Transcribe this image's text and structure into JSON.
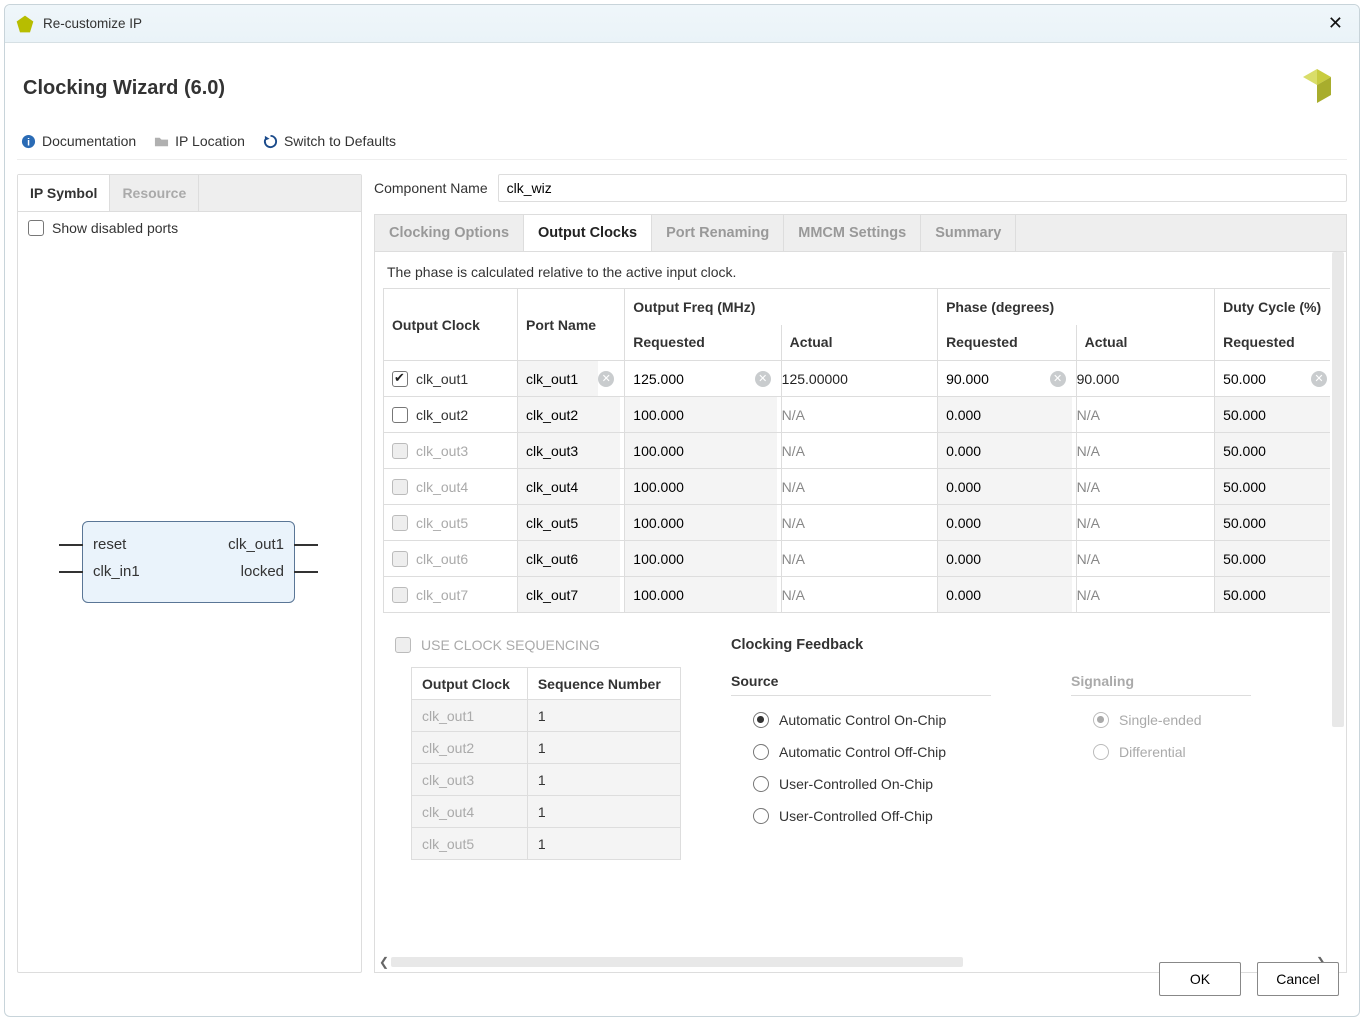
{
  "window": {
    "title": "Re-customize IP"
  },
  "header": {
    "title": "Clocking Wizard (6.0)"
  },
  "toolbar": {
    "documentation": "Documentation",
    "ip_location": "IP Location",
    "switch_defaults": "Switch to Defaults"
  },
  "left_panel": {
    "tabs": {
      "ip_symbol": "IP Symbol",
      "resource": "Resource"
    },
    "show_disabled": "Show disabled ports",
    "symbol": {
      "reset": "reset",
      "clk_in1": "clk_in1",
      "clk_out1": "clk_out1",
      "locked": "locked"
    }
  },
  "component": {
    "label": "Component Name",
    "value": "clk_wiz"
  },
  "right_tabs": {
    "clocking_options": "Clocking Options",
    "output_clocks": "Output Clocks",
    "port_renaming": "Port Renaming",
    "mmcm_settings": "MMCM Settings",
    "summary": "Summary"
  },
  "desc": "The phase is calculated relative to the active input clock.",
  "table": {
    "headers": {
      "output_clock": "Output Clock",
      "port_name": "Port Name",
      "freq": "Output Freq (MHz)",
      "phase": "Phase (degrees)",
      "duty": "Duty Cycle (%)",
      "requested": "Requested",
      "actual": "Actual"
    },
    "rows": [
      {
        "enabled": true,
        "name": "clk_out1",
        "port": "clk_out1",
        "freq_req": "125.000",
        "freq_act": "125.00000",
        "phase_req": "90.000",
        "phase_act": "90.000",
        "duty_req": "50.000",
        "row_active": true
      },
      {
        "enabled": false,
        "name": "clk_out2",
        "port": "clk_out2",
        "freq_req": "100.000",
        "freq_act": "N/A",
        "phase_req": "0.000",
        "phase_act": "N/A",
        "duty_req": "50.000",
        "row_active": true
      },
      {
        "enabled": false,
        "name": "clk_out3",
        "port": "clk_out3",
        "freq_req": "100.000",
        "freq_act": "N/A",
        "phase_req": "0.000",
        "phase_act": "N/A",
        "duty_req": "50.000",
        "row_active": false
      },
      {
        "enabled": false,
        "name": "clk_out4",
        "port": "clk_out4",
        "freq_req": "100.000",
        "freq_act": "N/A",
        "phase_req": "0.000",
        "phase_act": "N/A",
        "duty_req": "50.000",
        "row_active": false
      },
      {
        "enabled": false,
        "name": "clk_out5",
        "port": "clk_out5",
        "freq_req": "100.000",
        "freq_act": "N/A",
        "phase_req": "0.000",
        "phase_act": "N/A",
        "duty_req": "50.000",
        "row_active": false
      },
      {
        "enabled": false,
        "name": "clk_out6",
        "port": "clk_out6",
        "freq_req": "100.000",
        "freq_act": "N/A",
        "phase_req": "0.000",
        "phase_act": "N/A",
        "duty_req": "50.000",
        "row_active": false
      },
      {
        "enabled": false,
        "name": "clk_out7",
        "port": "clk_out7",
        "freq_req": "100.000",
        "freq_act": "N/A",
        "phase_req": "0.000",
        "phase_act": "N/A",
        "duty_req": "50.000",
        "row_active": false
      }
    ]
  },
  "sequencing": {
    "label": "USE CLOCK SEQUENCING",
    "headers": {
      "output_clock": "Output Clock",
      "sequence_number": "Sequence Number"
    },
    "rows": [
      {
        "name": "clk_out1",
        "seq": "1"
      },
      {
        "name": "clk_out2",
        "seq": "1"
      },
      {
        "name": "clk_out3",
        "seq": "1"
      },
      {
        "name": "clk_out4",
        "seq": "1"
      },
      {
        "name": "clk_out5",
        "seq": "1"
      }
    ]
  },
  "feedback": {
    "title": "Clocking Feedback",
    "source": {
      "label": "Source",
      "auto_on": "Automatic Control On-Chip",
      "auto_off": "Automatic Control Off-Chip",
      "user_on": "User-Controlled On-Chip",
      "user_off": "User-Controlled Off-Chip"
    },
    "signaling": {
      "label": "Signaling",
      "single": "Single-ended",
      "diff": "Differential"
    }
  },
  "footer": {
    "ok": "OK",
    "cancel": "Cancel"
  }
}
